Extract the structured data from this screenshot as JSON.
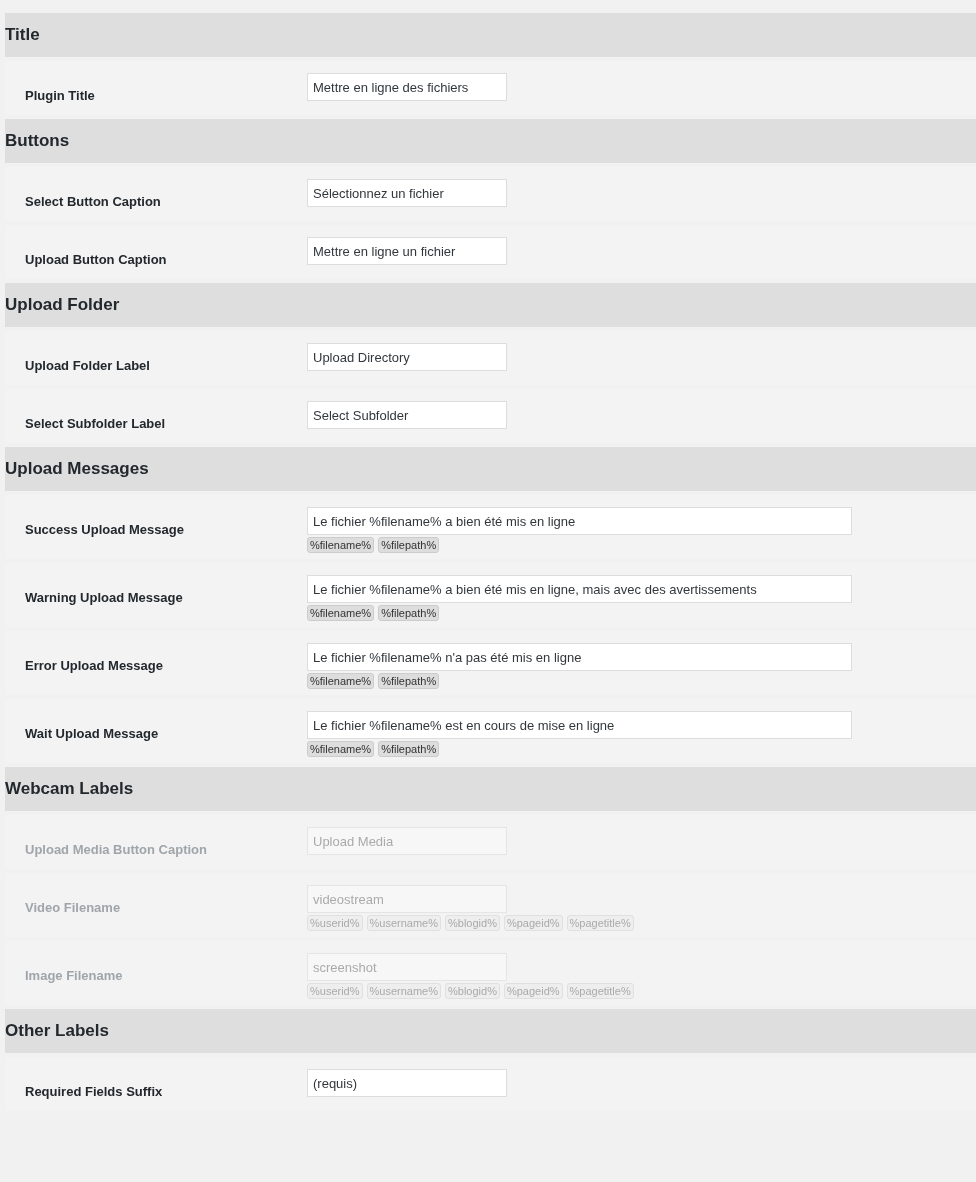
{
  "sections": [
    {
      "title": "Title",
      "fields": [
        {
          "label": "Plugin Title",
          "value": "Mettre en ligne des fichiers",
          "kind": "short",
          "disabled": false
        }
      ]
    },
    {
      "title": "Buttons",
      "fields": [
        {
          "label": "Select Button Caption",
          "value": "Sélectionnez un fichier",
          "kind": "short",
          "disabled": false
        },
        {
          "label": "Upload Button Caption",
          "value": "Mettre en ligne un fichier",
          "kind": "short",
          "disabled": false
        }
      ]
    },
    {
      "title": "Upload Folder",
      "fields": [
        {
          "label": "Upload Folder Label",
          "value": "Upload Directory",
          "kind": "short",
          "disabled": false
        },
        {
          "label": "Select Subfolder Label",
          "value": "Select Subfolder",
          "kind": "short",
          "disabled": false
        }
      ]
    },
    {
      "title": "Upload Messages",
      "fields": [
        {
          "label": "Success Upload Message",
          "value": "Le fichier %filename% a bien été mis en ligne",
          "kind": "long",
          "disabled": false,
          "tags": [
            "%filename%",
            "%filepath%"
          ]
        },
        {
          "label": "Warning Upload Message",
          "value": "Le fichier %filename% a bien été mis en ligne, mais avec des avertissements",
          "kind": "long",
          "disabled": false,
          "tags": [
            "%filename%",
            "%filepath%"
          ]
        },
        {
          "label": "Error Upload Message",
          "value": "Le fichier %filename% n'a pas été mis en ligne",
          "kind": "long",
          "disabled": false,
          "tags": [
            "%filename%",
            "%filepath%"
          ]
        },
        {
          "label": "Wait Upload Message",
          "value": "Le fichier %filename% est en cours de mise en ligne",
          "kind": "long",
          "disabled": false,
          "tags": [
            "%filename%",
            "%filepath%"
          ]
        }
      ]
    },
    {
      "title": "Webcam Labels",
      "fields": [
        {
          "label": "Upload Media Button Caption",
          "value": "Upload Media",
          "kind": "short",
          "disabled": true
        },
        {
          "label": "Video Filename",
          "value": "videostream",
          "kind": "short",
          "disabled": true,
          "tags": [
            "%userid%",
            "%username%",
            "%blogid%",
            "%pageid%",
            "%pagetitle%"
          ]
        },
        {
          "label": "Image Filename",
          "value": "screenshot",
          "kind": "short",
          "disabled": true,
          "tags": [
            "%userid%",
            "%username%",
            "%blogid%",
            "%pageid%",
            "%pagetitle%"
          ]
        }
      ]
    },
    {
      "title": "Other Labels",
      "fields": [
        {
          "label": "Required Fields Suffix",
          "value": "(requis)",
          "kind": "short",
          "disabled": false
        }
      ]
    }
  ]
}
